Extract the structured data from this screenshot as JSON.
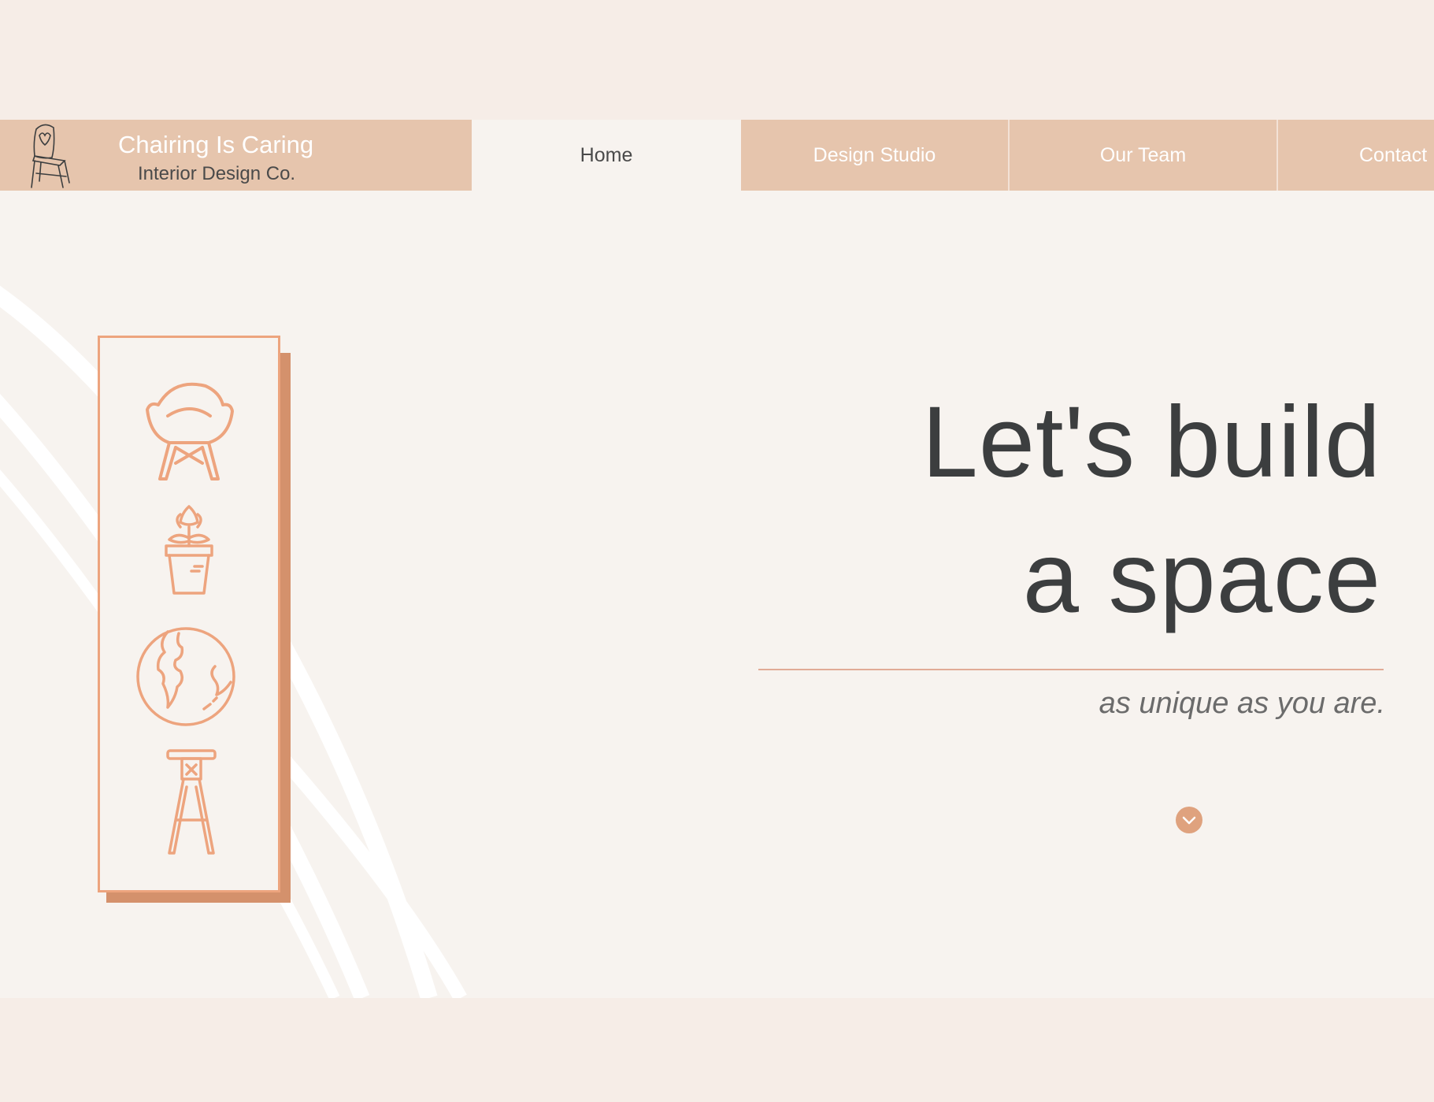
{
  "brand": {
    "name": "Chairing Is Caring",
    "subtitle": "Interior Design Co."
  },
  "nav": {
    "items": [
      {
        "label": "Home",
        "active": true
      },
      {
        "label": "Design Studio",
        "active": false
      },
      {
        "label": "Our Team",
        "active": false
      },
      {
        "label": "Contact",
        "active": false
      }
    ]
  },
  "hero": {
    "line1": "Let's build",
    "line2": "a space",
    "tagline": "as unique as you are."
  },
  "icons": {
    "logo": "chair-heart-icon",
    "card": [
      "armchair-icon",
      "potted-plant-icon",
      "globe-icon",
      "bar-stool-icon"
    ],
    "scroll": "chevron-down-icon"
  },
  "colors": {
    "accent": "#e6c5ad",
    "icon_orange": "#eda47e",
    "card_shadow": "#d4916c",
    "text_dark": "#3c3e3f",
    "background": "#f7f3ef"
  }
}
